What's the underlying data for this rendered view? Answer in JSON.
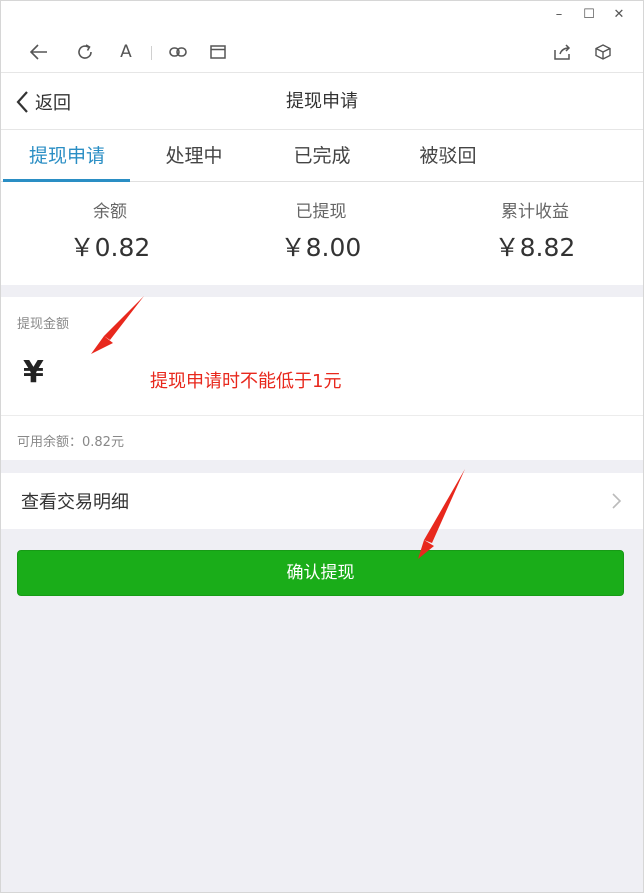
{
  "window": {
    "minimize_glyph": "–",
    "maximize_glyph": "☐",
    "close_glyph": "✕"
  },
  "toolbar": {
    "font_glyph": "A",
    "icons": [
      "back-arrow-icon",
      "refresh-icon",
      "font-icon",
      "link-icon",
      "window-icon",
      "share-icon",
      "cube-icon"
    ]
  },
  "navbar": {
    "back_label": "返回",
    "title": "提现申请"
  },
  "tabs": [
    {
      "label": "提现申请",
      "active": true
    },
    {
      "label": "处理中",
      "active": false
    },
    {
      "label": "已完成",
      "active": false
    },
    {
      "label": "被驳回",
      "active": false
    }
  ],
  "stats": [
    {
      "label": "余额",
      "value": "￥0.82"
    },
    {
      "label": "已提现",
      "value": "￥8.00"
    },
    {
      "label": "累计收益",
      "value": "￥8.82"
    }
  ],
  "amount": {
    "label": "提现金额",
    "currency_symbol": "¥",
    "value": "",
    "placeholder": "",
    "available": "可用余额：0.82元"
  },
  "annotation": {
    "text": "提现申请时不能低于1元",
    "color": "#e8281d"
  },
  "detail": {
    "label": "查看交易明细"
  },
  "confirm": {
    "label": "确认提现",
    "color": "#1aad19"
  },
  "colors": {
    "accent": "#2a8ec4",
    "background": "#efeff4"
  }
}
